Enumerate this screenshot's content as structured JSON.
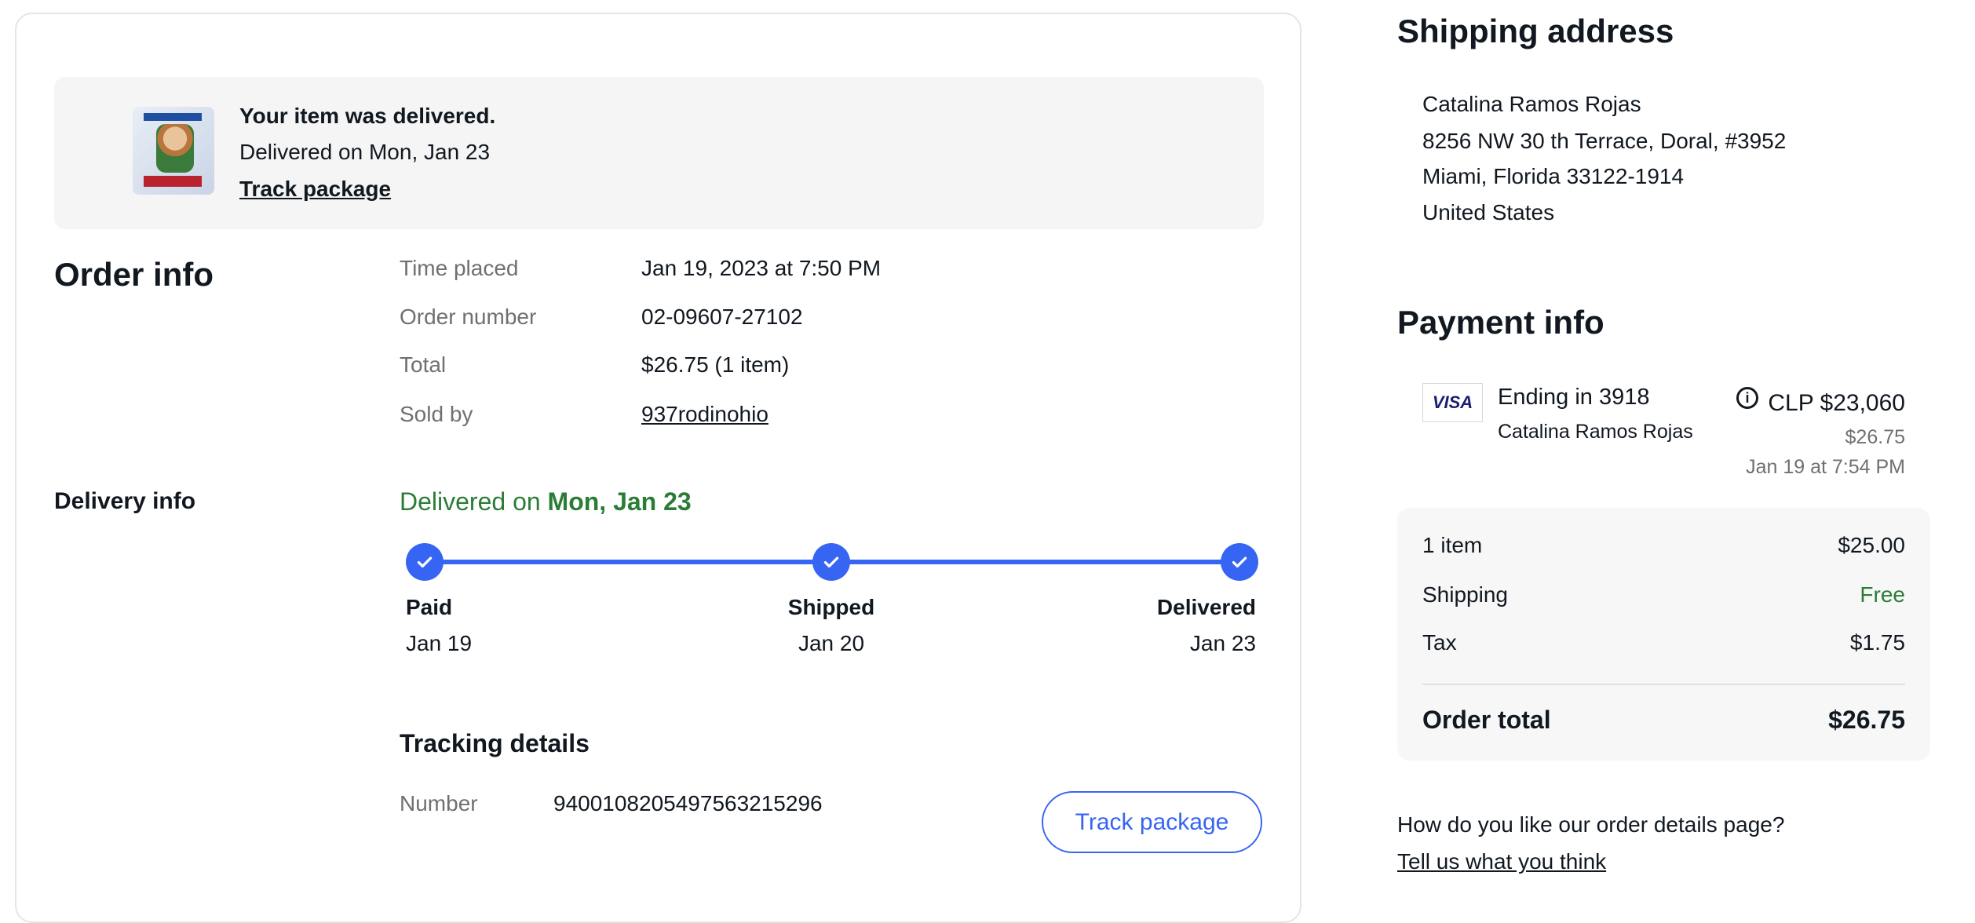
{
  "banner": {
    "title": "Your item was delivered.",
    "subtitle": "Delivered on Mon, Jan 23",
    "track_link": "Track package"
  },
  "order_info": {
    "heading": "Order info",
    "rows": [
      {
        "label": "Time placed",
        "value": "Jan 19, 2023 at 7:50 PM"
      },
      {
        "label": "Order number",
        "value": "02-09607-27102"
      },
      {
        "label": "Total",
        "value": "$26.75 (1 item)"
      },
      {
        "label": "Sold by",
        "value": "937rodinohio"
      }
    ]
  },
  "delivery_info": {
    "heading": "Delivery info",
    "status_prefix": "Delivered on ",
    "status_date": "Mon, Jan 23",
    "steps": [
      {
        "label": "Paid",
        "date": "Jan 19"
      },
      {
        "label": "Shipped",
        "date": "Jan 20"
      },
      {
        "label": "Delivered",
        "date": "Jan 23"
      }
    ],
    "tracking_heading": "Tracking details",
    "number_label": "Number",
    "number_value": "9400108205497563215296",
    "track_button": "Track package"
  },
  "shipping_address": {
    "heading": "Shipping address",
    "lines": [
      "Catalina Ramos Rojas",
      "8256 NW 30 th Terrace, Doral, #3952",
      "Miami, Florida 33122-1914",
      "United States"
    ]
  },
  "payment_info": {
    "heading": "Payment info",
    "card_brand": "VISA",
    "card_ending": "Ending in 3918",
    "card_holder": "Catalina Ramos Rojas",
    "charged_amount": "CLP $23,060",
    "usd_amount": "$26.75",
    "charged_time": "Jan 19 at 7:54 PM"
  },
  "summary": {
    "rows": [
      {
        "label": "1 item",
        "value": "$25.00"
      },
      {
        "label": "Shipping",
        "value": "Free"
      },
      {
        "label": "Tax",
        "value": "$1.75"
      }
    ],
    "total_label": "Order total",
    "total_value": "$26.75"
  },
  "feedback": {
    "question": "How do you like our order details page?",
    "link": "Tell us what you think"
  },
  "colors": {
    "accent": "#3665f3",
    "success": "#2b7d36",
    "text": "#111820",
    "muted": "#707070"
  }
}
